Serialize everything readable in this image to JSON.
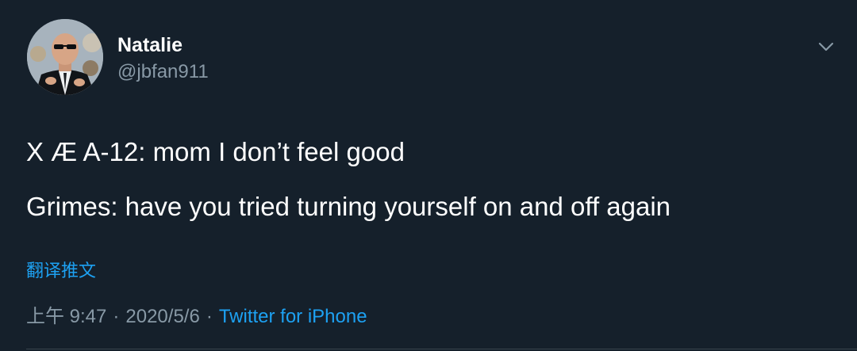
{
  "colors": {
    "background": "#15202b",
    "text": "#ffffff",
    "secondary_text": "#8899a6",
    "accent": "#1da1f2",
    "divider": "#38444d"
  },
  "user": {
    "display_name": "Natalie",
    "handle": "@jbfan911",
    "avatar_icon": "profile-photo"
  },
  "menu": {
    "icon": "chevron-down-icon"
  },
  "tweet": {
    "lines": [
      "X Æ A-12: mom I don’t feel good",
      "Grimes: have you tried turning yourself on and off again"
    ],
    "translate_label": "翻译推文"
  },
  "meta": {
    "time": "上午 9:47",
    "separator": "·",
    "date": "2020/5/6",
    "source": "Twitter for iPhone"
  }
}
